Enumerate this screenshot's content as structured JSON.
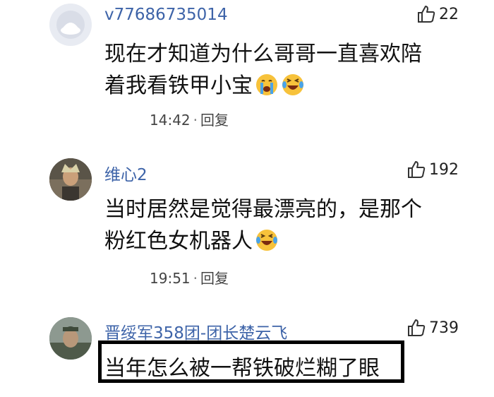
{
  "comments": [
    {
      "username": "v77686735014",
      "likes": "22",
      "text_line1": "现在才知道为什么哥哥一直喜欢陪",
      "text_line2": "着我看铁甲小宝",
      "emojis": [
        "crying-face-emoji",
        "laughing-tears-emoji"
      ],
      "time": "14:42",
      "reply": "回复"
    },
    {
      "username": "维心2",
      "likes": "192",
      "text_line1": "当时居然是觉得最漂亮的，是那个",
      "text_line2": "粉红色女机器人",
      "emojis": [
        "laughing-tears-emoji"
      ],
      "time": "19:51",
      "reply": "回复"
    },
    {
      "username": "晋绥军358团-团长楚云飞",
      "likes": "739",
      "text_line1": "当年怎么被一帮铁破烂糊了眼"
    }
  ],
  "separator": "·",
  "colors": {
    "username": "#3d63a8",
    "text": "#111111",
    "meta": "#444444",
    "highlight_border": "#000000"
  },
  "icons": [
    "default-avatar-icon",
    "thumbs-up-icon"
  ]
}
